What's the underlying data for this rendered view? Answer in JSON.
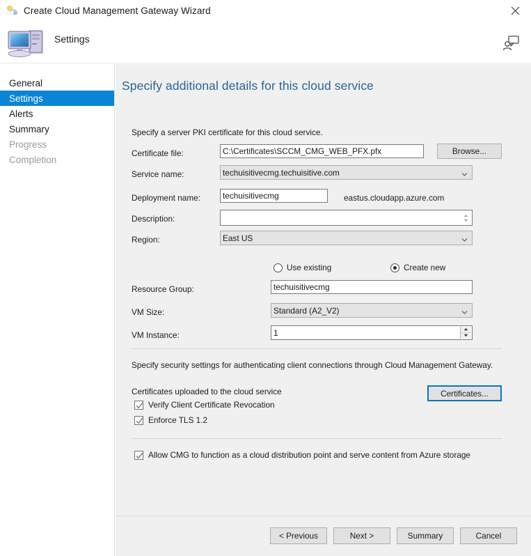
{
  "window": {
    "title": "Create Cloud Management Gateway Wizard",
    "title_icon": "cloud-wizard-icon",
    "close_icon": "close-icon"
  },
  "header": {
    "title": "Settings",
    "icon": "computer-icon",
    "feedback_icon": "feedback-person-icon"
  },
  "sidebar": {
    "items": [
      {
        "label": "General",
        "state": "normal"
      },
      {
        "label": "Settings",
        "state": "selected"
      },
      {
        "label": "Alerts",
        "state": "normal"
      },
      {
        "label": "Summary",
        "state": "normal"
      },
      {
        "label": "Progress",
        "state": "disabled"
      },
      {
        "label": "Completion",
        "state": "disabled"
      }
    ],
    "selected_color": "#0a84d4"
  },
  "main": {
    "heading": "Specify additional details for this cloud service",
    "heading_color": "#2a6496",
    "pki_intro": "Specify a server PKI certificate for this cloud service.",
    "security_intro": "Specify security settings for authenticating client connections through Cloud Management Gateway.",
    "fields": {
      "certificate_file": {
        "label": "Certificate file:",
        "value": "C:\\Certificates\\SCCM_CMG_WEB_PFX.pfx",
        "placeholder": ""
      },
      "service_name": {
        "label": "Service name:",
        "value": "techuisitivecmg.techuisitive.com"
      },
      "deployment_name": {
        "label": "Deployment name:",
        "value": "techuisitivecmg",
        "suffix": "eastus.cloudapp.azure.com"
      },
      "description": {
        "label": "Description:",
        "value": "",
        "placeholder": ""
      },
      "region": {
        "label": "Region:",
        "value": "East US"
      },
      "resource_group": {
        "label": "Resource Group:",
        "value": "techuisitivecmg"
      },
      "vm_size": {
        "label": "VM Size:",
        "value": "Standard (A2_V2)"
      },
      "vm_instance": {
        "label": "VM Instance:",
        "value": "1"
      }
    },
    "resource_group_mode": {
      "use_existing": {
        "label": "Use existing",
        "selected": false
      },
      "create_new": {
        "label": "Create new",
        "selected": true
      }
    },
    "browse_button": "Browse...",
    "certificates_label": "Certificates uploaded to the cloud service",
    "certificates_button": "Certificates...",
    "checkboxes": [
      {
        "label": "Verify Client Certificate Revocation",
        "checked": true
      },
      {
        "label": "Enforce TLS 1.2",
        "checked": true
      }
    ],
    "cdp_checkbox": {
      "label": "Allow CMG to function as a cloud distribution point and serve content from Azure storage",
      "checked": true
    }
  },
  "footer": {
    "previous": "< Previous",
    "next": "Next >",
    "summary": "Summary",
    "cancel": "Cancel"
  }
}
